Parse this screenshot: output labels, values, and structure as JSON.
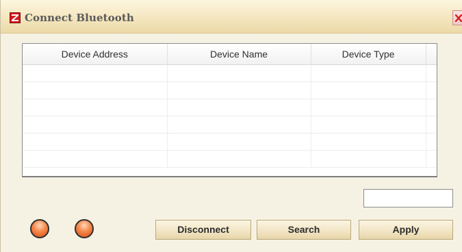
{
  "window": {
    "title": "Connect Bluetooth",
    "close_icon": "close-x-icon",
    "app_icon": "app-logo-icon"
  },
  "table": {
    "columns": [
      "Device Address",
      "Device Name",
      "Device Type"
    ],
    "rows": [
      [
        "",
        "",
        ""
      ],
      [
        "",
        "",
        ""
      ],
      [
        "",
        "",
        ""
      ],
      [
        "",
        "",
        ""
      ],
      [
        "",
        "",
        ""
      ],
      [
        "",
        "",
        ""
      ]
    ]
  },
  "status_field": {
    "value": ""
  },
  "indicators": [
    {
      "name": "status-led-1",
      "color": "#f0763a"
    },
    {
      "name": "status-led-2",
      "color": "#f0763a"
    }
  ],
  "buttons": {
    "disconnect": "Disconnect",
    "search": "Search",
    "apply": "Apply"
  },
  "colors": {
    "titlebar": "#f4e6bf",
    "window_bg": "#f6f2e3",
    "close_red": "#d61d1d",
    "app_icon_red": "#d6181d"
  }
}
